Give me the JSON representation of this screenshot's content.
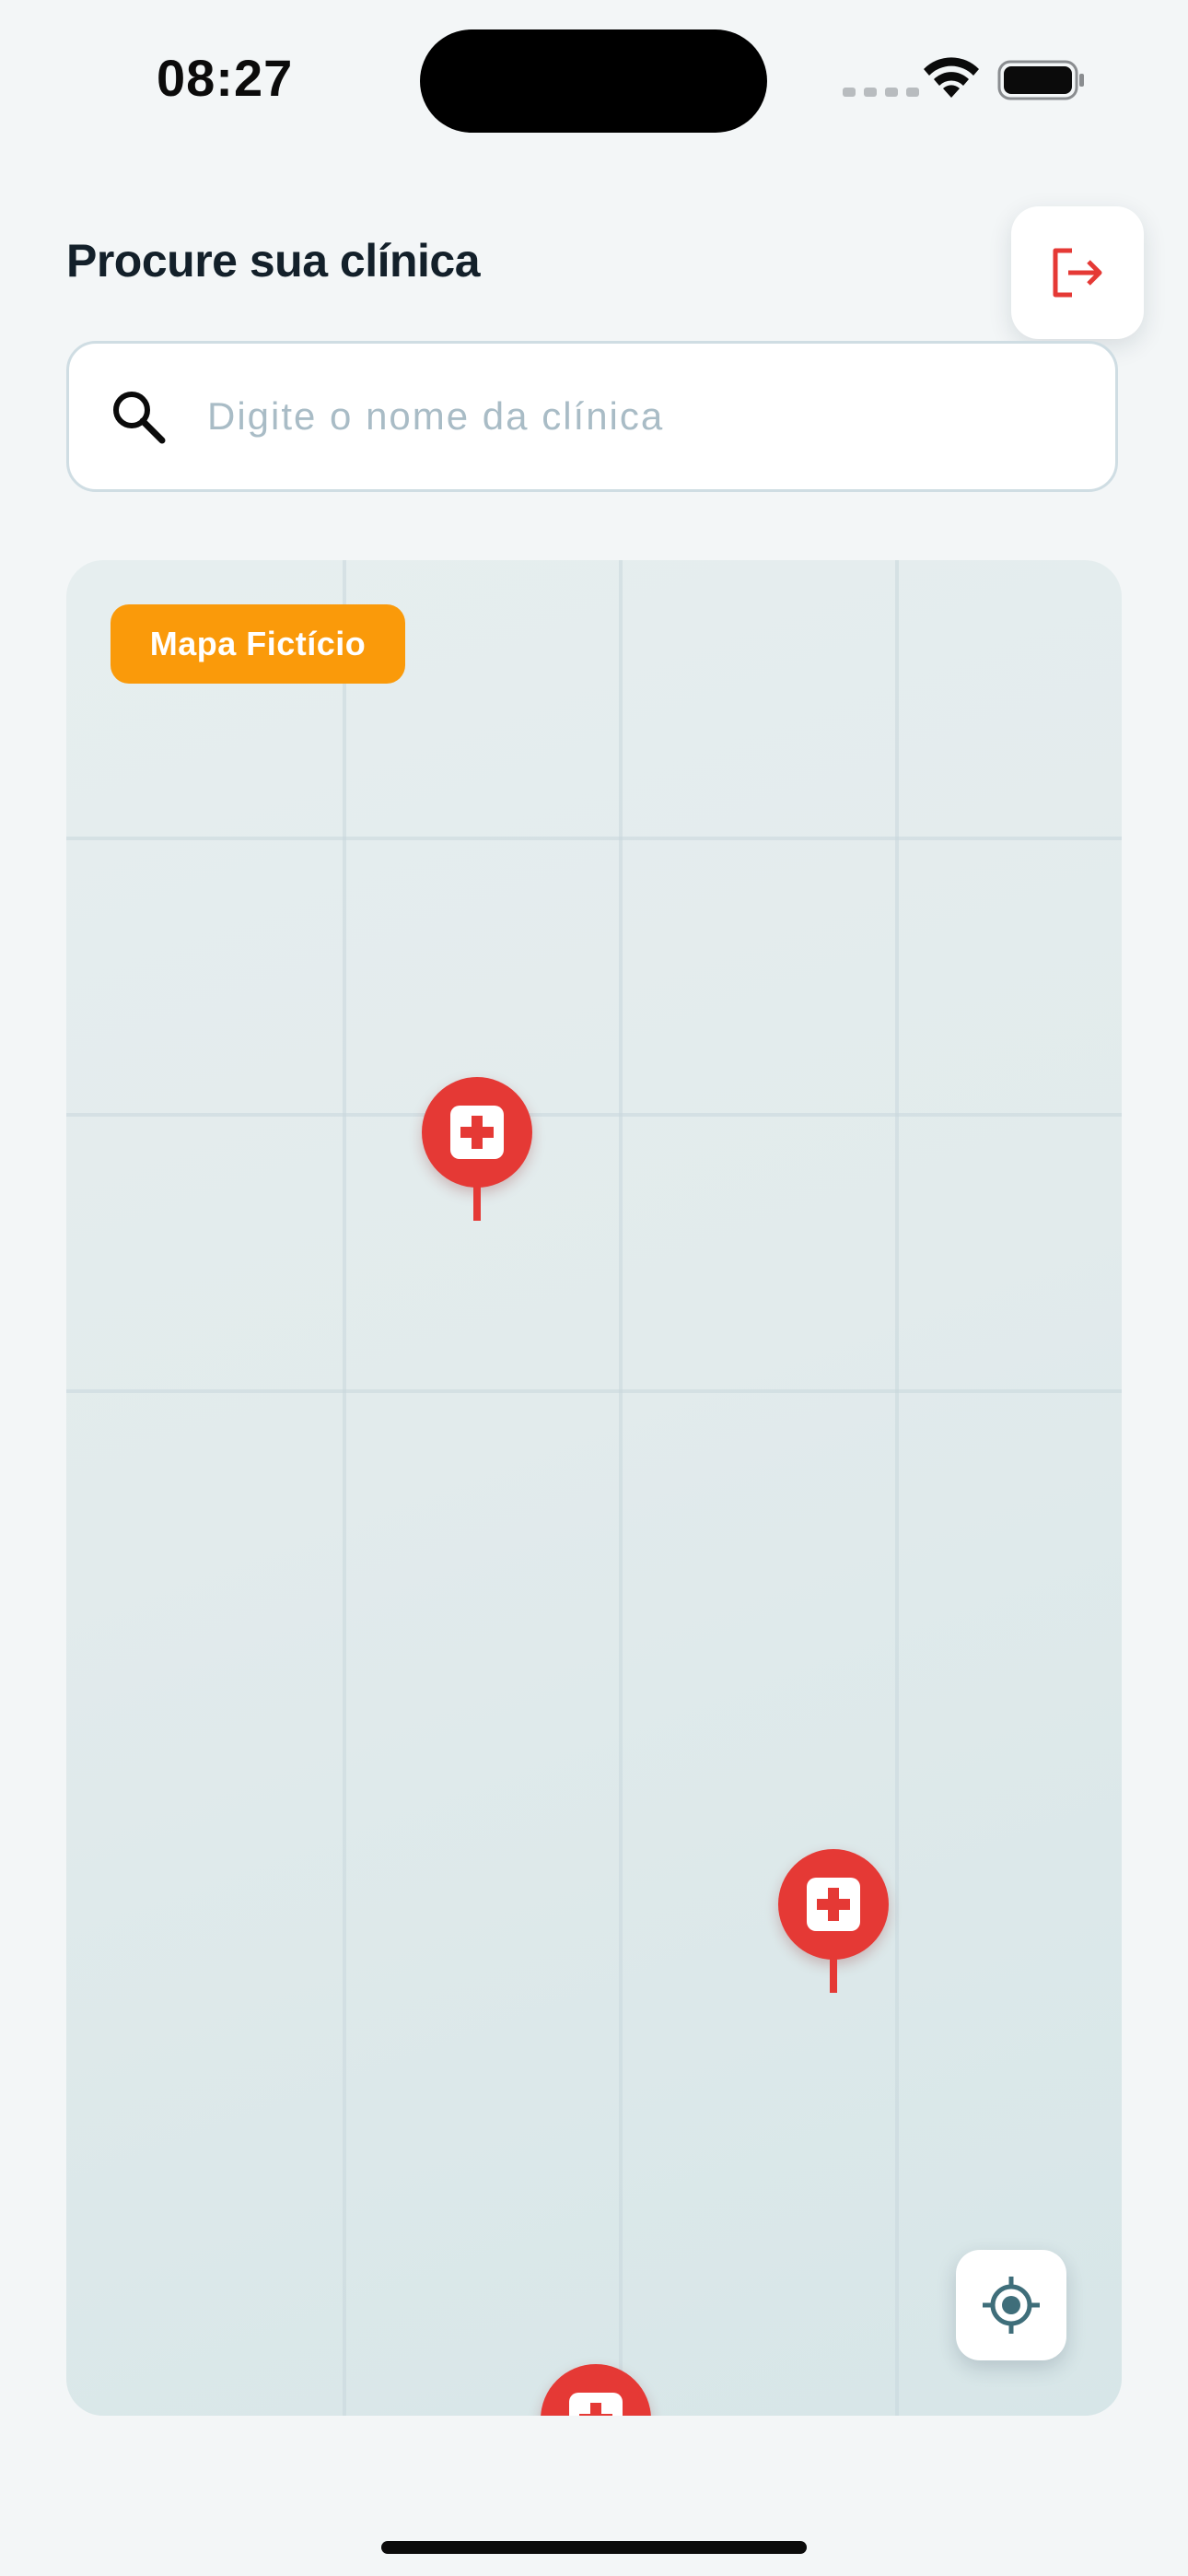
{
  "status_bar": {
    "time": "08:27",
    "icons": [
      "cellular-signal-icon",
      "wifi-icon",
      "battery-icon"
    ]
  },
  "header": {
    "title": "Procure sua clínica",
    "logout_icon": "logout-icon"
  },
  "search": {
    "placeholder": "Digite o nome da clínica",
    "value": "",
    "icon": "search-icon"
  },
  "map": {
    "badge_label": "Mapa Fictício",
    "pin_icon": "medical-cross-icon",
    "locate_icon": "crosshair-location-icon"
  },
  "colors": {
    "accent_red": "#e53935",
    "badge_orange": "#fa9a0a",
    "locate_teal": "#3f6e7a",
    "title_text": "#13202a",
    "placeholder_text": "#a9bcc6"
  }
}
